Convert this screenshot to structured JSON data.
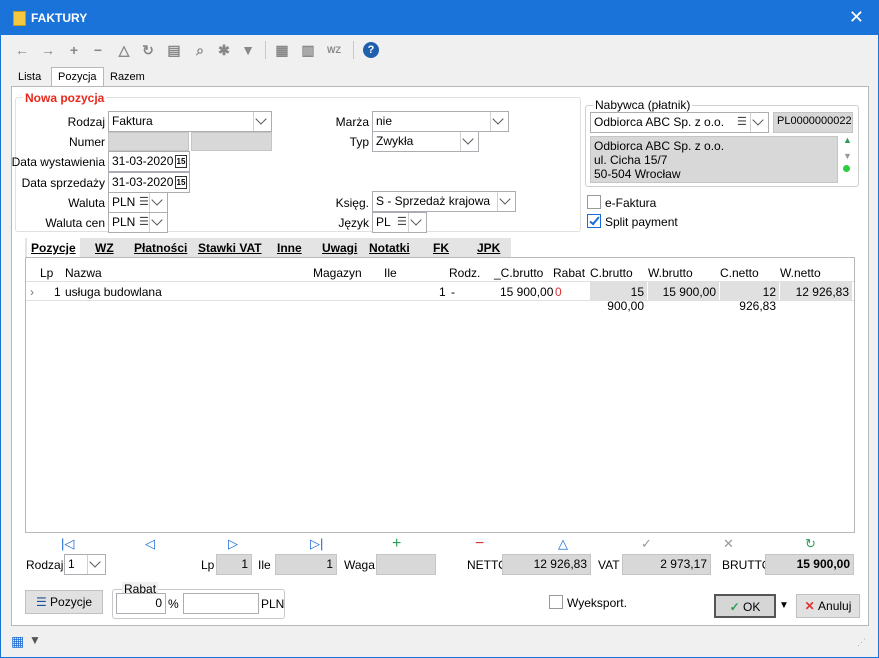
{
  "window": {
    "title": "FAKTURY",
    "close_glyph": "✕"
  },
  "toolbar": {
    "icons": [
      "arrow-left-icon",
      "arrow-right-icon",
      "plus-icon",
      "minus-icon",
      "triangle-icon",
      "refresh-icon",
      "print-icon",
      "zoom-icon",
      "settings-icon",
      "filter-icon",
      "export-icon",
      "copy-icon",
      "wz-icon",
      "help-icon"
    ]
  },
  "main_tabs": [
    "Lista",
    "Pozycja",
    "Razem"
  ],
  "form": {
    "section_title": "Nowa pozycja",
    "rodzaj_label": "Rodzaj",
    "rodzaj_value": "Faktura",
    "numer_label": "Numer",
    "data_wyst_label": "Data wystawienia",
    "data_wyst_value": "31-03-2020",
    "data_sprz_label": "Data sprzedaży",
    "data_sprz_value": "31-03-2020",
    "waluta_label": "Waluta",
    "waluta_value": "PLN",
    "waluta_cen_label": "Waluta cen",
    "waluta_cen_value": "PLN",
    "marza_label": "Marża",
    "marza_value": "nie",
    "typ_label": "Typ",
    "typ_value": "Zwykła",
    "ksieg_label": "Księg.",
    "ksieg_value": "S - Sprzedaż krajowa",
    "jezyk_label": "Język",
    "jezyk_value": "PL",
    "cal_glyph": "15"
  },
  "nabywca": {
    "group_label": "Nabywca (płatnik)",
    "name": "Odbiorca ABC Sp. z o.o.",
    "nip": "PL0000000022",
    "address_lines": [
      "Odbiorca ABC Sp. z o.o.",
      "ul. Cicha 15/7",
      "50-504 Wrocław"
    ]
  },
  "checks": {
    "efaktura_label": "e-Faktura",
    "efaktura_checked": false,
    "split_label": "Split payment",
    "split_checked": true
  },
  "sub_tabs": [
    "Pozycje",
    "WZ",
    "Płatności",
    "Stawki VAT",
    "Inne",
    "Uwagi",
    "Notatki",
    "FK",
    "JPK"
  ],
  "grid": {
    "columns": [
      "Lp",
      "Nazwa",
      "Magazyn",
      "Ile",
      "Rodz.",
      "_C.brutto",
      "Rabat",
      "C.brutto",
      "W.brutto",
      "C.netto",
      "W.netto"
    ],
    "rows": [
      {
        "lp": "1",
        "nazwa": "usługa budowlana",
        "magazyn": "",
        "ile": "1",
        "rodz": "-",
        "c_brutto_": "15 900,00",
        "rabat": "0",
        "c_brutto": "15 900,00",
        "w_brutto": "15 900,00",
        "c_netto": "12 926,83",
        "w_netto": "12 926,83"
      }
    ]
  },
  "bottom": {
    "rodzaj_label": "Rodzaj",
    "rodzaj_value": "1",
    "lp_label": "Lp",
    "lp_value": "1",
    "ile_label": "Ile",
    "ile_value": "1",
    "waga_label": "Waga",
    "waga_value": "",
    "netto_label": "NETTO",
    "netto_value": "12 926,83",
    "vat_label": "VAT",
    "vat_value": "2 973,17",
    "brutto_label": "BRUTTO",
    "brutto_value": "15 900,00",
    "pozycje_button": "Pozycje",
    "rabat_group": "Rabat",
    "rabat_pct_value": "0",
    "pct_sign": "%",
    "rabat_pln_value": "",
    "pln_label": "PLN",
    "wyeksport_label": "Wyeksport.",
    "ok_label": "OK",
    "anuluj_label": "Anuluj"
  },
  "colors": {
    "accent": "#1a73d9",
    "required": "#e8281b",
    "grid_shade": "#e0e0e0",
    "add": "#2a9d5a",
    "del": "#d33"
  }
}
